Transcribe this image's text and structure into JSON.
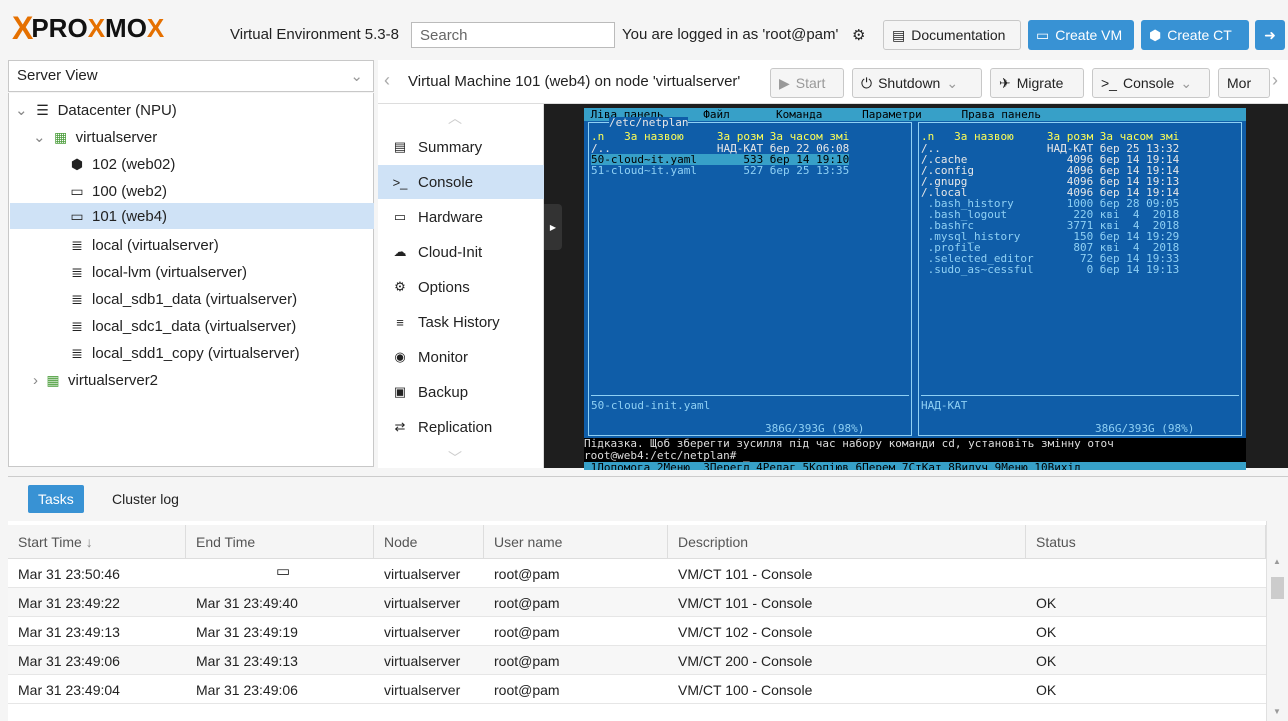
{
  "brand": {
    "logo_x": "X",
    "logo_text_a": "PRO",
    "logo_x2": "X",
    "logo_text_b": "MO",
    "logo_x3": "X",
    "version": "Virtual Environment 5.3-8"
  },
  "header": {
    "search_placeholder": "Search",
    "logged_in": "You are logged in as 'root@pam'",
    "doc_label": "Documentation",
    "create_vm": "Create VM",
    "create_ct": "Create CT"
  },
  "sidebar": {
    "view": "Server View",
    "nodes": [
      {
        "label": "Datacenter (NPU)",
        "icon": "datacenter-icon"
      },
      {
        "label": "virtualserver",
        "icon": "server-icon"
      },
      {
        "label": "102 (web02)",
        "icon": "container-icon"
      },
      {
        "label": "100 (web2)",
        "icon": "vm-icon"
      },
      {
        "label": "101 (web4)",
        "icon": "vm-icon"
      },
      {
        "label": "local (virtualserver)",
        "icon": "storage-icon"
      },
      {
        "label": "local-lvm (virtualserver)",
        "icon": "storage-icon"
      },
      {
        "label": "local_sdb1_data (virtualserver)",
        "icon": "storage-icon"
      },
      {
        "label": "local_sdc1_data (virtualserver)",
        "icon": "storage-icon"
      },
      {
        "label": "local_sdd1_copy (virtualserver)",
        "icon": "storage-icon"
      },
      {
        "label": "virtualserver2",
        "icon": "server-icon"
      }
    ]
  },
  "vm": {
    "title": "Virtual Machine 101 (web4) on node 'virtualserver'",
    "start": "Start",
    "shutdown": "Shutdown",
    "migrate": "Migrate",
    "console": "Console",
    "more": "Mor"
  },
  "submenu": [
    "Summary",
    "Console",
    "Hardware",
    "Cloud-Init",
    "Options",
    "Task History",
    "Monitor",
    "Backup",
    "Replication"
  ],
  "terminal": {
    "menubar": " Ліва панель      Файл       Команда      Параметри      Права панель",
    "left_path": "/etc/netplan",
    "left_hdr": ".n   За назвою     За розм За часом змі",
    "left_lines": [
      "/..                НАД-КАТ бер 22 06:08",
      "50-cloud~it.yaml       533 бер 14 19:10",
      "51-cloud~it.yaml       527 бер 25 13:35"
    ],
    "right_hdr": ".n   За назвою     За розм За часом змі",
    "right_lines": [
      "/..                НАД-КАТ бер 25 13:32",
      "/.cache               4096 бер 14 19:14",
      "/.config              4096 бер 14 19:14",
      "/.gnupg               4096 бер 14 19:13",
      "/.local               4096 бер 14 19:14",
      " .bash_history        1000 бер 28 09:05",
      " .bash_logout          220 кві  4  2018",
      " .bashrc              3771 кві  4  2018",
      " .mysql_history        150 бер 14 19:29",
      " .profile              807 кві  4  2018",
      " .selected_editor       72 бер 14 19:33",
      " .sudo_as~cessful        0 бер 14 19:13"
    ],
    "left_status": "50-cloud-init.yaml",
    "right_status": "НАД-КАТ",
    "left_free": "386G/393G (98%)",
    "right_free": "386G/393G (98%)",
    "hint": "Підказка. Щоб зберегти зусилля під час набору команди cd, установіть змінну оточ",
    "prompt": "root@web4:/etc/netplan# _",
    "fkeys": " 1Допомога 2Меню  3Перегл 4Редаг 5Копіюв 6Перем 7СтКат 8Вилуч 9Меню 10Вихід"
  },
  "tasks": {
    "tab_tasks": "Tasks",
    "tab_cluster": "Cluster log",
    "columns": [
      "Start Time",
      "End Time",
      "Node",
      "User name",
      "Description",
      "Status"
    ],
    "rows": [
      [
        "Mar 31 23:50:46",
        "",
        "virtualserver",
        "root@pam",
        "VM/CT 101 - Console",
        ""
      ],
      [
        "Mar 31 23:49:22",
        "Mar 31 23:49:40",
        "virtualserver",
        "root@pam",
        "VM/CT 101 - Console",
        "OK"
      ],
      [
        "Mar 31 23:49:13",
        "Mar 31 23:49:19",
        "virtualserver",
        "root@pam",
        "VM/CT 102 - Console",
        "OK"
      ],
      [
        "Mar 31 23:49:06",
        "Mar 31 23:49:13",
        "virtualserver",
        "root@pam",
        "VM/CT 200 - Console",
        "OK"
      ],
      [
        "Mar 31 23:49:04",
        "Mar 31 23:49:06",
        "virtualserver",
        "root@pam",
        "VM/CT 100 - Console",
        "OK"
      ]
    ]
  },
  "colors": {
    "accent": "#3892d4",
    "brand_orange": "#e57000",
    "selection": "#cfe2f6"
  }
}
